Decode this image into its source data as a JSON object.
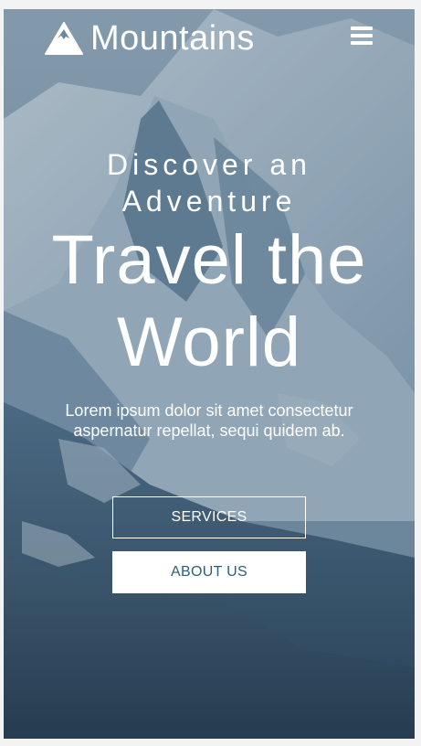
{
  "nav": {
    "brand_name": "Mountains",
    "logo_icon": "mountain-triangle-icon",
    "menu_icon": "hamburger-menu-icon"
  },
  "hero": {
    "kicker": "Discover an Adventure",
    "title": "Travel the World",
    "text": "Lorem ipsum dolor sit amet consectetur aspernatur repellat, sequi quidem ab."
  },
  "buttons": {
    "services_label": "SERVICES",
    "about_label": "ABOUT US"
  },
  "colors": {
    "text_primary": "#ffffff",
    "about_button_text": "#2f5e78",
    "overlay": "#163652"
  }
}
